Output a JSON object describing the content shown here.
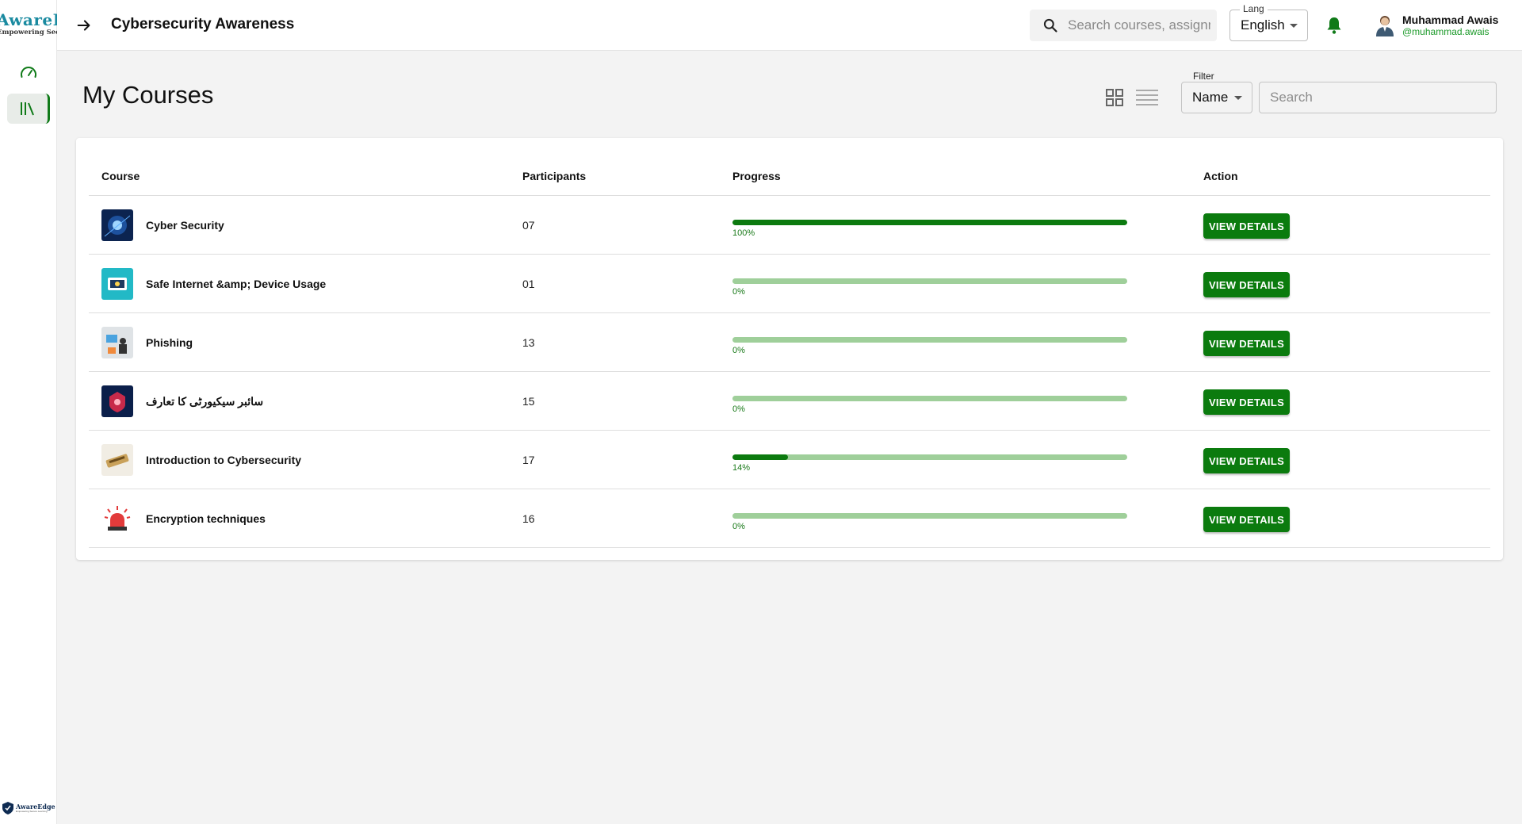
{
  "sidebar": {
    "logo_title": "AwareEdge",
    "logo_subtitle": "Empowering Secure Learning",
    "footer_logo_title": "AwareEdge",
    "footer_logo_subtitle": "Empowering Secure Learning"
  },
  "header": {
    "title": "Cybersecurity Awareness",
    "search_placeholder": "Search courses, assignments",
    "lang_label": "Lang",
    "lang_value": "English",
    "user_name": "Muhammad Awais",
    "user_handle": "@muhammad.awais"
  },
  "page": {
    "title": "My Courses",
    "filter_label": "Filter",
    "filter_value": "Name",
    "search_placeholder": "Search"
  },
  "table": {
    "columns": [
      "Course",
      "Participants",
      "Progress",
      "Action"
    ],
    "rows": [
      {
        "course": "Cyber Security",
        "participants": "07",
        "progress": 100,
        "progress_label": "100%",
        "action": "VIEW DETAILS",
        "thumb_icon": "cyber-security-thumb"
      },
      {
        "course": "Safe Internet &amp; Device Usage",
        "participants": "01",
        "progress": 0,
        "progress_label": "0%",
        "action": "VIEW DETAILS",
        "thumb_icon": "safe-internet-thumb"
      },
      {
        "course": "Phishing",
        "participants": "13",
        "progress": 0,
        "progress_label": "0%",
        "action": "VIEW DETAILS",
        "thumb_icon": "phishing-thumb"
      },
      {
        "course": "سائبر سیکیورٹی کا تعارف",
        "participants": "15",
        "progress": 0,
        "progress_label": "0%",
        "action": "VIEW DETAILS",
        "thumb_icon": "urdu-course-thumb"
      },
      {
        "course": "Introduction to Cybersecurity",
        "participants": "17",
        "progress": 14,
        "progress_label": "14%",
        "action": "VIEW DETAILS",
        "thumb_icon": "intro-cyber-thumb"
      },
      {
        "course": "Encryption techniques",
        "participants": "16",
        "progress": 0,
        "progress_label": "0%",
        "action": "VIEW DETAILS",
        "thumb_icon": "siren-thumb"
      }
    ]
  },
  "colors": {
    "accent": "#0b7b0e",
    "progress_track": "#9fcf9a",
    "handle": "#1c9a2a"
  }
}
